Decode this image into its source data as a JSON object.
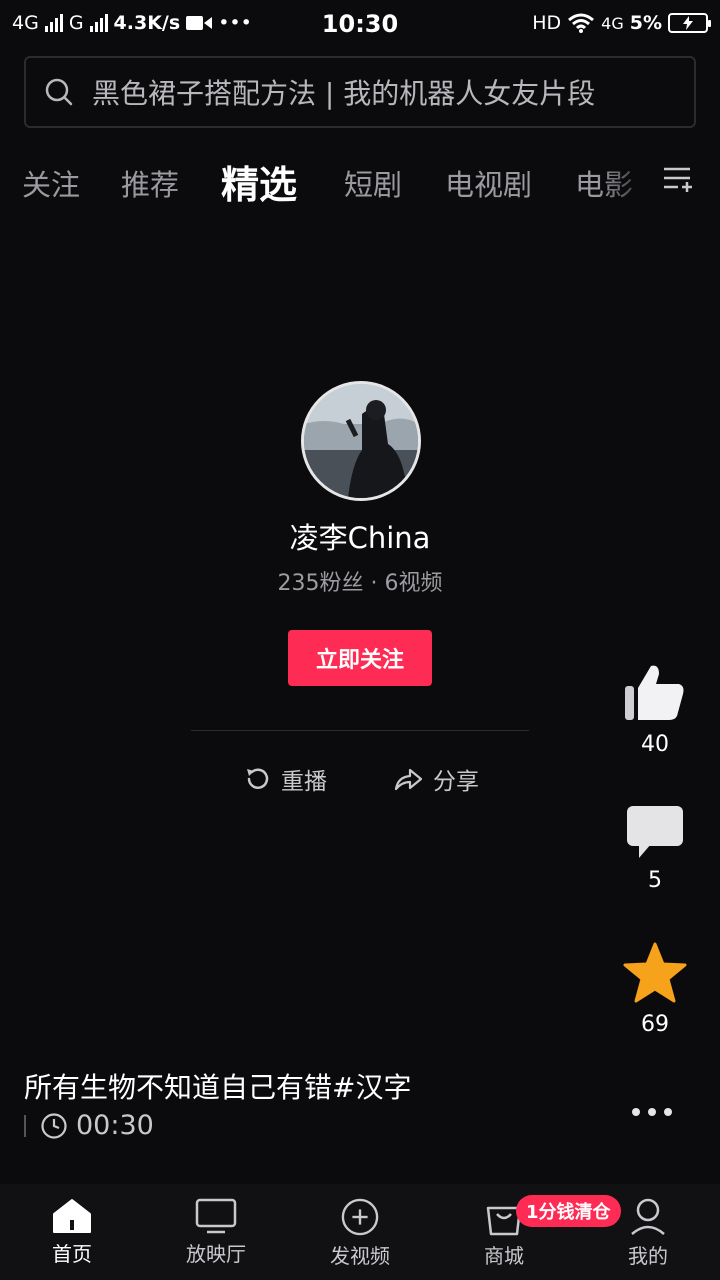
{
  "status_bar": {
    "network_left": "4G",
    "network_mid": "G",
    "speed": "4.3K/s",
    "more": "•••",
    "time": "10:30",
    "hd": "HD",
    "network_right": "4G",
    "battery": "5%"
  },
  "search": {
    "placeholder": "黑色裙子搭配方法 | 我的机器人女友片段"
  },
  "tabs": [
    {
      "label": "关注"
    },
    {
      "label": "推荐"
    },
    {
      "label": "精选",
      "active": true
    },
    {
      "label": "短剧"
    },
    {
      "label": "电视剧"
    },
    {
      "label": "电影"
    }
  ],
  "profile": {
    "username": "凌李China",
    "stats": "235粉丝 · 6视频",
    "follow_label": "立即关注"
  },
  "actions": {
    "replay": "重播",
    "share": "分享"
  },
  "rail": {
    "likes": "40",
    "comments": "5",
    "favorites": "69"
  },
  "video": {
    "caption": "所有生物不知道自己有错#汉字",
    "duration": "00:30"
  },
  "bottom_nav": {
    "home": "首页",
    "theater": "放映厅",
    "post": "发视频",
    "mall": "商城",
    "me": "我的",
    "mall_badge": "1分钱清仓"
  },
  "colors": {
    "accent": "#fe2c55",
    "background": "#0b0b0d",
    "star": "#f7a21b"
  }
}
